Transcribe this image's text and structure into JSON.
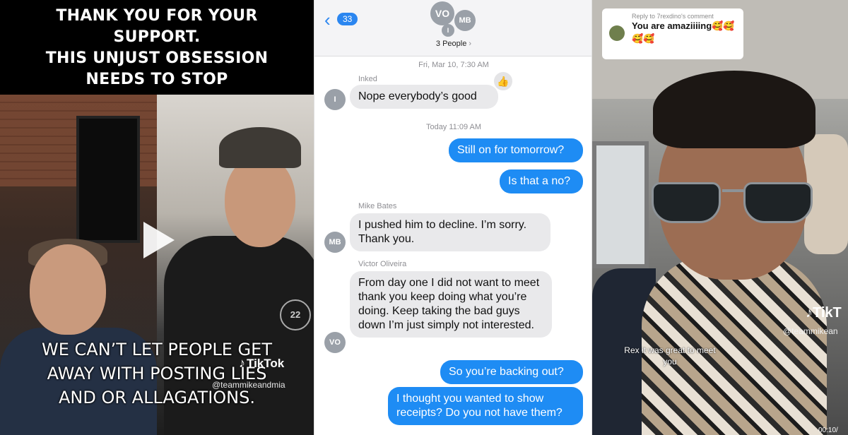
{
  "left_panel": {
    "caption_top": [
      "THANK YOU FOR YOUR",
      "SUPPORT.",
      "THIS UNJUST OBSESSION",
      "NEEDS TO STOP"
    ],
    "caption_bottom": [
      "WE CAN’T LET PEOPLE GET",
      "AWAY WITH POSTING LIES",
      "AND OR ALLAGATIONS."
    ],
    "badge_text": "22",
    "watermark": "TikTok",
    "handle": "@teammikeandmia"
  },
  "messages_panel": {
    "back_count": "33",
    "avatars": [
      "VO",
      "MB",
      "I"
    ],
    "group_label": "3 People",
    "stamp1": "Fri, Mar 10, 7:30 AM",
    "stamp2": "Today 11:09 AM",
    "messages": [
      {
        "sender": "Inked",
        "avatar": "I",
        "text": "Nope everybody’s good",
        "dir": "in"
      },
      {
        "text": "Still on for tomorrow?",
        "dir": "out"
      },
      {
        "text": "Is that a no?",
        "dir": "out"
      },
      {
        "sender": "Mike  Bates",
        "avatar": "MB",
        "text": "I pushed him to decline. I’m sorry. Thank you.",
        "dir": "in"
      },
      {
        "sender": "Victor Oliveira",
        "avatar": "VO",
        "text": "From day one I did not want to meet thank you keep doing what you’re doing. Keep taking the bad guys down I’m just simply not interested.",
        "dir": "in"
      },
      {
        "text": "So you’re backing out?",
        "dir": "out"
      },
      {
        "text": "I thought you wanted to show receipts? Do you not have them?",
        "dir": "out"
      }
    ]
  },
  "right_panel": {
    "reply_header": "Reply to 7rexdino's comment",
    "reply_text": "You are amaziiiing🥰🥰🥰🥰",
    "watermark": "TikT",
    "handle": "@teammikean",
    "comment": "Rex it was great to meet you",
    "timestamp": "00:10/"
  }
}
